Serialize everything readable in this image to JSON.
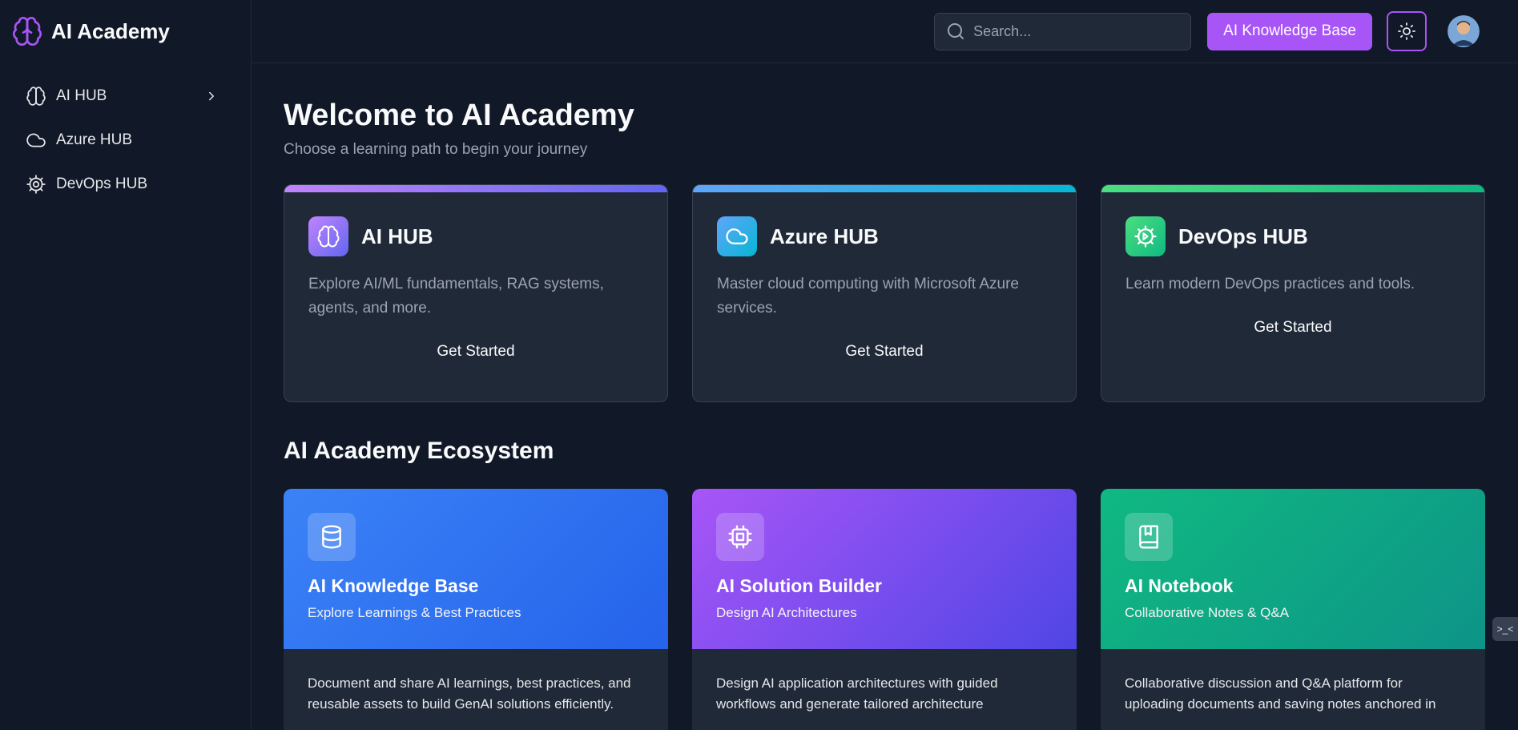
{
  "brand": {
    "name": "AI Academy"
  },
  "sidebar": {
    "items": [
      {
        "label": "AI HUB",
        "icon": "brain-icon",
        "has_chevron": true
      },
      {
        "label": "Azure HUB",
        "icon": "cloud-icon"
      },
      {
        "label": "DevOps HUB",
        "icon": "gear-icon"
      }
    ]
  },
  "topbar": {
    "search_placeholder": "Search...",
    "kb_button": "AI Knowledge Base",
    "theme_icon": "sun-icon"
  },
  "main": {
    "title": "Welcome to AI Academy",
    "subtitle": "Choose a learning path to begin your journey",
    "hubs": [
      {
        "title": "AI HUB",
        "description": "Explore AI/ML fundamentals, RAG systems, agents, and more.",
        "cta": "Get Started",
        "icon": "brain-icon",
        "gradient": [
          "#c084fc",
          "#6366f1"
        ]
      },
      {
        "title": "Azure HUB",
        "description": "Master cloud computing with Microsoft Azure services.",
        "cta": "Get Started",
        "icon": "cloud-icon",
        "gradient": [
          "#60a5fa",
          "#06b6d4"
        ]
      },
      {
        "title": "DevOps HUB",
        "description": "Learn modern DevOps practices and tools.",
        "cta": "Get Started",
        "icon": "gear-icon",
        "gradient": [
          "#4ade80",
          "#10b981"
        ]
      }
    ],
    "ecosystem_title": "AI Academy Ecosystem",
    "ecosystem": [
      {
        "title": "AI Knowledge Base",
        "subtitle": "Explore Learnings & Best Practices",
        "description": "Document and share AI learnings, best practices, and reusable assets to build GenAI solutions efficiently.",
        "icon": "database-icon",
        "gradient": [
          "#3b82f6",
          "#2563eb"
        ]
      },
      {
        "title": "AI Solution Builder",
        "subtitle": "Design AI Architectures",
        "description": "Design AI application architectures with guided workflows and generate tailored architecture",
        "icon": "chip-icon",
        "gradient": [
          "#a855f7",
          "#4f46e5"
        ]
      },
      {
        "title": "AI Notebook",
        "subtitle": "Collaborative Notes & Q&A",
        "description": "Collaborative discussion and Q&A platform for uploading documents and saving notes anchored in",
        "icon": "notebook-icon",
        "gradient": [
          "#10b981",
          "#0d9488"
        ]
      }
    ]
  },
  "float_button": {
    "label": ">_<"
  }
}
